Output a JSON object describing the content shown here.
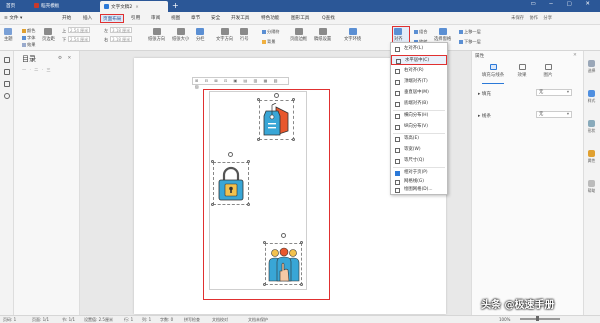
{
  "tabs": [
    {
      "label": "首页"
    },
    {
      "label": "稻壳模板"
    },
    {
      "label": "文字文稿2"
    }
  ],
  "menu": {
    "file": "文件",
    "items": [
      "开始",
      "插入",
      "页面布局",
      "引用",
      "审阅",
      "视图",
      "章节",
      "安全",
      "开发工具",
      "特色功能",
      "图形工具"
    ],
    "search": "Q查找",
    "user": {
      "unsaved": "未保存",
      "collab": "协作",
      "share": "分享"
    }
  },
  "ribbon": {
    "theme": "主题",
    "colors": "颜色",
    "fonts": "字体",
    "effects": "效果",
    "margins": "页边距",
    "top_label": "上",
    "top_value": "2.54 厘米",
    "bottom_label": "下",
    "bottom_value": "2.54 厘米",
    "left_label": "左",
    "left_value": "3.18 厘米",
    "right_label": "右",
    "right_value": "3.18 厘米",
    "orientation": "纸张方向",
    "size": "纸张大小",
    "columns": "分栏",
    "text_direction": "文字方向",
    "line_numbers": "行号",
    "breaks": "分隔符",
    "background": "背景",
    "page_border": "页面边框",
    "draft_paper": "稿纸设置",
    "wrap_text": "文字环绕",
    "align": "对齐",
    "rotate": "旋转",
    "group": "组合",
    "select_pane": "选择窗格",
    "bring_forward": "上移一层",
    "send_backward": "下移一层"
  },
  "left_sidebar": {
    "toc_title": "目录",
    "toc_sub": "一 · 二 · 三"
  },
  "float_toolbar_icons": "⊞ ⊟ ⊠ ⊡ ▣ ▤ ▥ ▦ ▧ ▨",
  "document": {
    "icons": [
      {
        "name": "price-tag-icon",
        "color": "#e8572d"
      },
      {
        "name": "lock-icon",
        "color": "#39a6d6"
      },
      {
        "name": "team-hand-icon",
        "color": "#e8572d"
      }
    ]
  },
  "align_menu": {
    "items": [
      {
        "label": "左对齐(L)",
        "icon": "align-left-icon"
      },
      {
        "label": "水平居中(C)",
        "icon": "align-center-icon",
        "highlighted": true
      },
      {
        "label": "右对齐(R)",
        "icon": "align-right-icon"
      },
      {
        "label": "顶端对齐(T)",
        "icon": "align-top-icon"
      },
      {
        "label": "垂直居中(M)",
        "icon": "align-middle-icon"
      },
      {
        "label": "底端对齐(B)",
        "icon": "align-bottom-icon"
      },
      {
        "label": "横向分布(H)",
        "icon": "distribute-h-icon"
      },
      {
        "label": "纵向分布(V)",
        "icon": "distribute-v-icon"
      },
      {
        "label": "等高(E)",
        "icon": "same-height-icon"
      },
      {
        "label": "等宽(W)",
        "icon": "same-width-icon"
      },
      {
        "label": "等尺寸(Q)",
        "icon": "same-size-icon"
      },
      {
        "label": "相对于页(P)",
        "icon": "relative-page-icon",
        "checked": true
      },
      {
        "label": "网格线(G)",
        "icon": "gridlines-icon"
      },
      {
        "label": "绘图网格(D)...",
        "icon": "drawing-grid-icon"
      }
    ]
  },
  "right_panel": {
    "title": "属性",
    "tabs": [
      "填充与线条",
      "效果",
      "图片"
    ],
    "fill_label": "填充",
    "fill_value": "无",
    "line_label": "线条",
    "line_value": "无",
    "strip": [
      "选择",
      "样式",
      "形状",
      "属性",
      "帮助"
    ]
  },
  "status_bar": {
    "page": "页码: 1",
    "pages": "页面: 1/1",
    "section": "节: 1/1",
    "position": "设置值: 2.5厘米",
    "line": "行: 1",
    "column": "列: 1",
    "word_count": "字数: 0",
    "spell": "拼写检查",
    "doc_check": "文档校对",
    "protect": "文档未保护",
    "zoom": "100%"
  },
  "watermark": "头条 @极速手册"
}
